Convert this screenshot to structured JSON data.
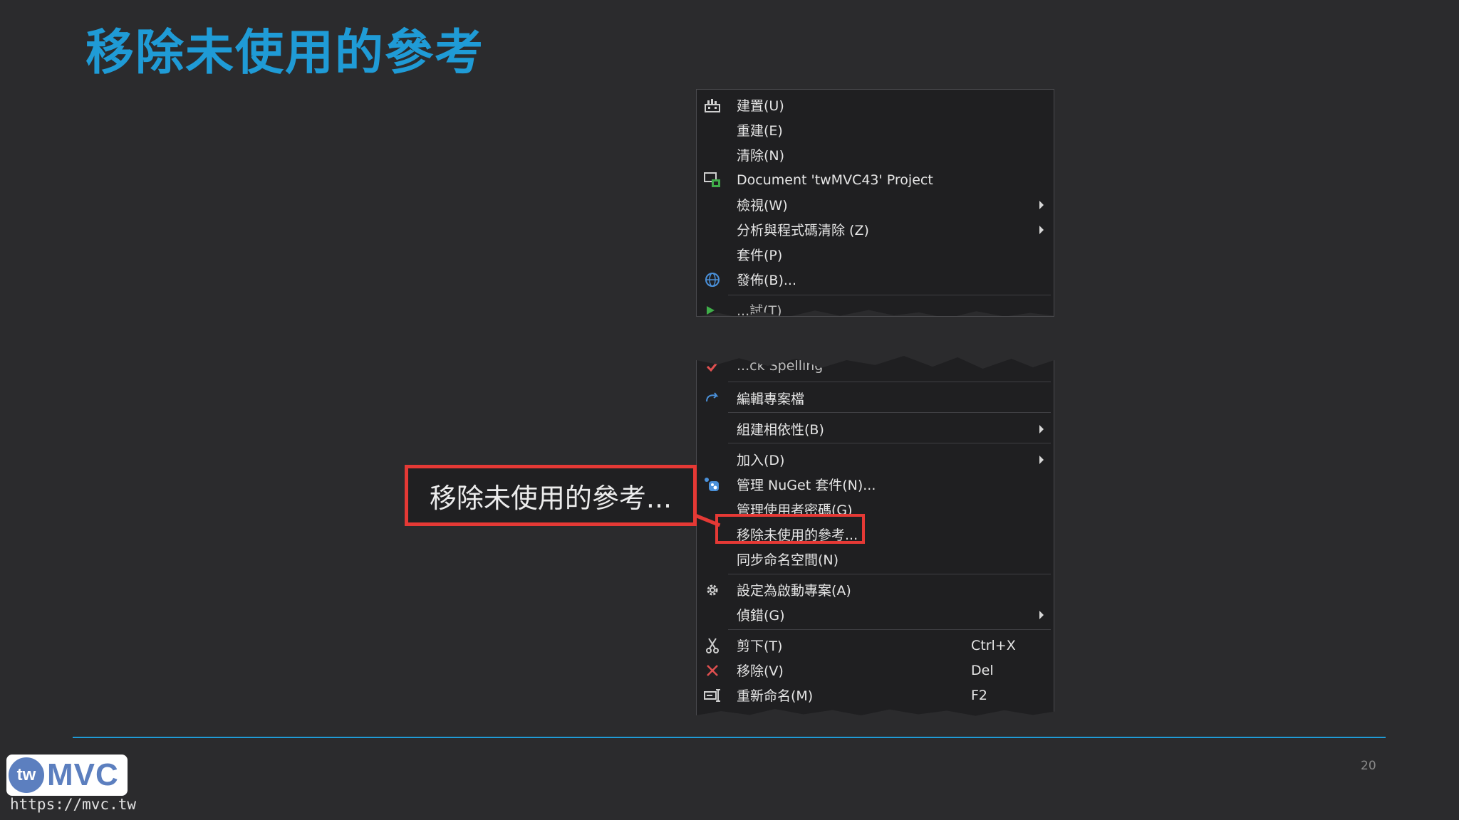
{
  "slide": {
    "title": "移除未使用的參考",
    "page_number": "20",
    "url": "https://mvc.tw",
    "logo": {
      "tw": "tw",
      "mvc": "MVC"
    }
  },
  "callout": {
    "label": "移除未使用的參考..."
  },
  "menu_top": [
    {
      "label": "建置(U)",
      "icon": "build-icon"
    },
    {
      "label": "重建(E)",
      "icon": ""
    },
    {
      "label": "清除(N)",
      "icon": ""
    },
    {
      "label": "Document 'twMVC43' Project",
      "icon": "document-project-icon"
    },
    {
      "label": "檢視(W)",
      "icon": "",
      "submenu": true
    },
    {
      "label": "分析與程式碼清除 (Z)",
      "icon": "",
      "submenu": true
    },
    {
      "label": "套件(P)",
      "icon": ""
    },
    {
      "label": "發佈(B)...",
      "icon": "globe-publish-icon"
    },
    {
      "label": "...試(T)",
      "icon": "test-icon",
      "partial": true
    }
  ],
  "menu_bottom": [
    {
      "label": "...ck Spelling",
      "icon": "spell-check-icon",
      "partial": true
    },
    {
      "label": "編輯專案檔",
      "icon": "edit-project-file-icon"
    },
    {
      "label": "組建相依性(B)",
      "icon": "",
      "submenu": true
    },
    {
      "label": "加入(D)",
      "icon": "",
      "submenu": true
    },
    {
      "label": "管理 NuGet 套件(N)...",
      "icon": "nuget-icon"
    },
    {
      "label": "管理使用者密碼(G)",
      "icon": ""
    },
    {
      "label": "移除未使用的參考...",
      "icon": "",
      "highlighted": true
    },
    {
      "label": "同步命名空間(N)",
      "icon": ""
    },
    {
      "label": "設定為啟動專案(A)",
      "icon": "gear-icon"
    },
    {
      "label": "偵錯(G)",
      "icon": "",
      "submenu": true
    },
    {
      "label": "剪下(T)",
      "icon": "scissors-icon",
      "shortcut": "Ctrl+X"
    },
    {
      "label": "移除(V)",
      "icon": "delete-x-icon",
      "shortcut": "Del"
    },
    {
      "label": "重新命名(M)",
      "icon": "rename-icon",
      "shortcut": "F2"
    }
  ],
  "colors": {
    "accent": "#1f9bd6",
    "highlight": "#e53935",
    "menu_bg": "#1f1f21",
    "slide_bg": "#2b2b2d"
  }
}
